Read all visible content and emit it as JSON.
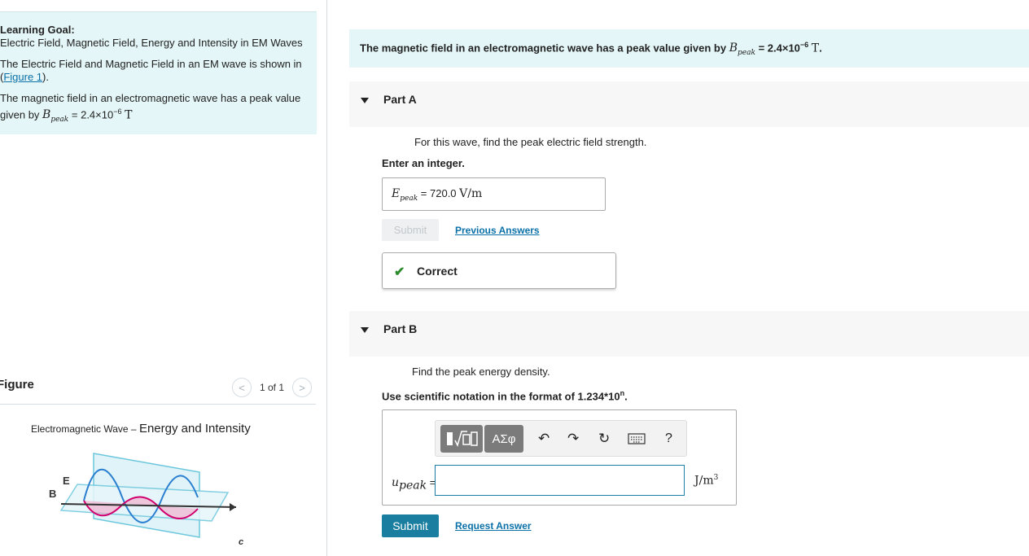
{
  "left": {
    "learning_goal_title": "Learning Goal:",
    "learning_goal_text": "Electric Field, Magnetic Field, Energy and Intensity in EM Waves",
    "intro_text": "The Electric Field and Magnetic Field in an EM wave is shown in",
    "figure_link": "Figure 1",
    "intro_end": ").",
    "field_text": "The magnetic field in an electromagnetic wave has a peak value",
    "field_text2": "given by",
    "field_eq": "= 2.4×10",
    "field_exp": "−6",
    "field_unit": "T"
  },
  "figure": {
    "title": "Figure",
    "pager_text": "1 of 1",
    "prev_glyph": "<",
    "next_glyph": ">",
    "caption_small": "Electromagnetic Wave – ",
    "caption_big": "Energy and Intensity",
    "label_E": "E",
    "label_B": "B",
    "label_c": "c"
  },
  "question": {
    "text_start": "The magnetic field in an electromagnetic wave has a peak value given by",
    "sym": "B",
    "sub": "peak",
    "eq": "= 2.4×10",
    "exp": "−6",
    "unit": "T",
    "end": "."
  },
  "partA": {
    "label": "Part A",
    "prompt": "For this wave, find the peak electric field strength.",
    "instruction": "Enter an integer.",
    "answer_sym": "E",
    "answer_sub": "peak",
    "answer_eq": "=",
    "answer_value": "720.0",
    "answer_unit": "V/m",
    "submit_label": "Submit",
    "previous_label": "Previous Answers",
    "correct_label": "Correct"
  },
  "partB": {
    "label": "Part B",
    "prompt": "Find the peak energy density.",
    "instruction": "Use scientific notation in the format of 1.234*10",
    "instruction_exp": "n",
    "instruction_end": ".",
    "toolbar_greek": "ΑΣφ",
    "help_glyph": "?",
    "input_sym": "u",
    "input_sub": "peak",
    "input_eq": "=",
    "input_value": "",
    "unit_base": "J/m",
    "unit_exp": "3",
    "submit_label": "Submit",
    "request_label": "Request Answer"
  },
  "colors": {
    "accent": "#197ea0",
    "link": "#0b71a8",
    "panel": "#e4f6f7",
    "correct": "#2d8b2d"
  }
}
